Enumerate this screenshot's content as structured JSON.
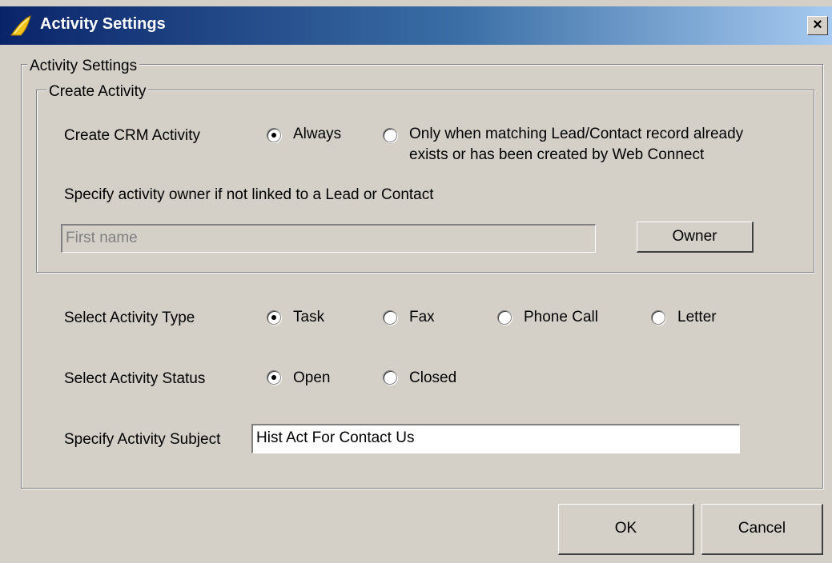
{
  "window": {
    "title": "Activity Settings",
    "close_glyph": "×",
    "icon": "app-icon"
  },
  "outer_group": {
    "label": "Activity Settings"
  },
  "create_group": {
    "label": "Create Activity",
    "create_crm_label": "Create CRM Activity",
    "options": {
      "always": {
        "label": "Always",
        "checked": true
      },
      "only_when": {
        "line1": "Only when matching Lead/Contact record already",
        "line2": "exists or has been created by Web Connect",
        "checked": false
      }
    },
    "owner_hint": "Specify activity owner if not linked to a Lead or Contact",
    "owner_field": {
      "placeholder": "First name",
      "value": ""
    },
    "owner_button": "Owner"
  },
  "activity_type": {
    "label": "Select Activity Type",
    "options": [
      {
        "label": "Task",
        "checked": true
      },
      {
        "label": "Fax",
        "checked": false
      },
      {
        "label": "Phone Call",
        "checked": false
      },
      {
        "label": "Letter",
        "checked": false
      }
    ]
  },
  "activity_status": {
    "label": "Select Activity Status",
    "options": [
      {
        "label": "Open",
        "checked": true
      },
      {
        "label": "Closed",
        "checked": false
      }
    ]
  },
  "subject": {
    "label": "Specify Activity Subject",
    "value": "Hist Act For Contact Us"
  },
  "buttons": {
    "ok": "OK",
    "cancel": "Cancel"
  },
  "colors": {
    "title_start": "#0a246a",
    "title_end": "#a6caf0",
    "face": "#d4d0c8",
    "icon": "#f0c419"
  }
}
